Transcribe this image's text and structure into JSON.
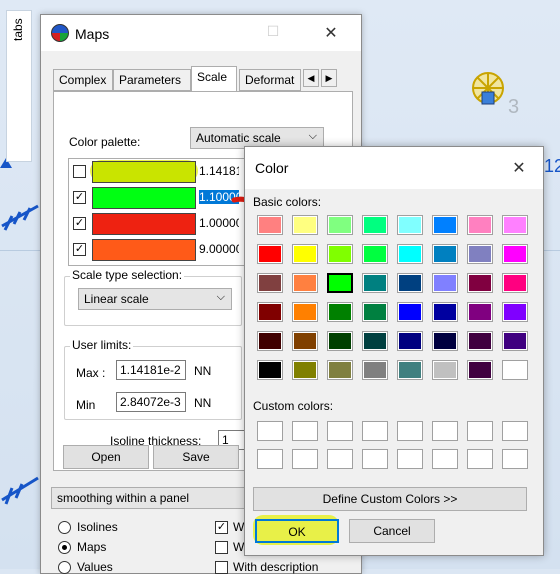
{
  "side_tab": {
    "label": "tabs"
  },
  "maps_window": {
    "title": "Maps",
    "tabs": [
      "Complex",
      "Parameters",
      "Scale",
      "Deformat"
    ],
    "color_palette_label": "Color palette:",
    "scale_mode": "Automatic scale",
    "palette_rows": [
      {
        "checked": false,
        "color": "#c9e400",
        "value": "1.14181"
      },
      {
        "checked": true,
        "color": "#00ff12",
        "value": "1.10000"
      },
      {
        "checked": true,
        "color": "#ee2211",
        "value": "1.00000"
      },
      {
        "checked": true,
        "color": "#ff5a18",
        "value": "9.00000"
      }
    ],
    "scale_type_label": "Scale type selection:",
    "scale_type_value": "Linear scale",
    "user_limits_label": "User limits:",
    "max_label": "Max :",
    "max_value": "1.14181e-2",
    "min_label": "Min",
    "min_value": "2.84072e-3",
    "unit": "NN",
    "isoline_label": "Isoline thickness:",
    "isoline_value": "1",
    "open_label": "Open",
    "save_label": "Save",
    "smoothing_value": "smoothing within a panel",
    "radio_isolines": "Isolines",
    "radio_maps": "Maps",
    "radio_values": "Values",
    "check_w1": "W",
    "check_w2": "W",
    "check_with_description": "With description"
  },
  "color_dialog": {
    "title": "Color",
    "basic_label": "Basic colors:",
    "custom_label": "Custom colors:",
    "define_label": "Define Custom Colors >>",
    "ok_label": "OK",
    "cancel_label": "Cancel",
    "basic_colors": [
      "#ff8080",
      "#ffff80",
      "#80ff80",
      "#00ff80",
      "#80ffff",
      "#0080ff",
      "#ff80c0",
      "#ff80ff",
      "#ff0000",
      "#ffff00",
      "#80ff00",
      "#00ff40",
      "#00ffff",
      "#0080c0",
      "#8080c0",
      "#ff00ff",
      "#804040",
      "#ff8040",
      "#00ff00",
      "#008080",
      "#004080",
      "#8080ff",
      "#800040",
      "#ff0080",
      "#800000",
      "#ff8000",
      "#008000",
      "#008040",
      "#0000ff",
      "#0000a0",
      "#800080",
      "#8000ff",
      "#400000",
      "#804000",
      "#004000",
      "#004040",
      "#000080",
      "#000040",
      "#400040",
      "#400080",
      "#000000",
      "#808000",
      "#808040",
      "#808080",
      "#408080",
      "#c0c0c0",
      "#400040",
      "#ffffff"
    ],
    "selected_index": 18
  },
  "scene": {
    "label_12": "12",
    "label_3": "3"
  }
}
